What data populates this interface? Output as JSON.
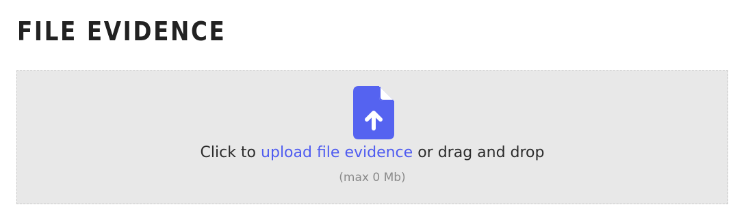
{
  "section": {
    "title": "FILE EVIDENCE"
  },
  "dropzone": {
    "icon": "file-upload-icon",
    "icon_color": "#5563f0",
    "prefix": "Click to",
    "link_text": "upload file evidence",
    "suffix": "or drag and drop",
    "limit_text": "(max 0 Mb)",
    "background_color": "#e8e8e8",
    "link_color": "#4f5cf0"
  }
}
